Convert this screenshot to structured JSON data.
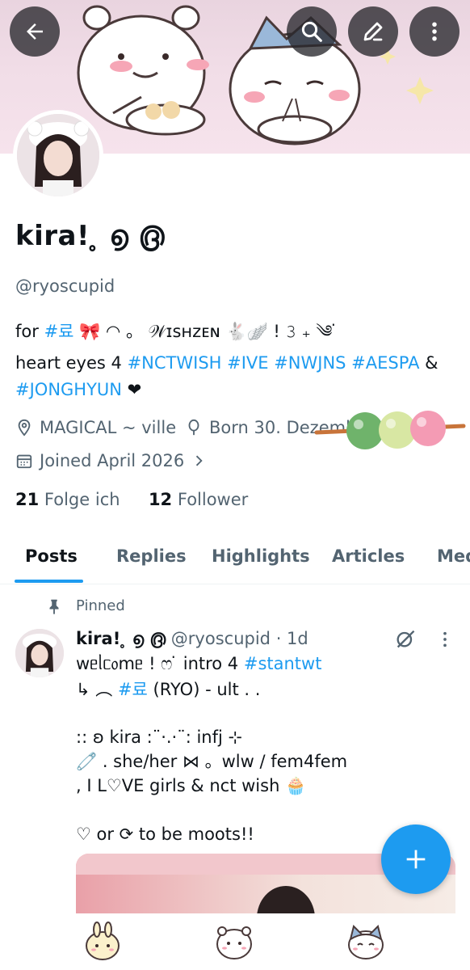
{
  "header": {
    "back_icon": "arrow-left-icon",
    "search_icon": "search-icon",
    "edit_icon": "pencil-icon",
    "more_icon": "more-vertical-icon"
  },
  "profile": {
    "display_name": "kira!  ̥ ൭ ൫",
    "handle": "@ryoscupid",
    "bio_line1_prefix": "for ",
    "bio_line1_tag": "#료",
    "bio_line1_suffix": " 🎀 ◠ 。 𝒲ɪsʜzᴇɴ 🐇🪽 ! 𝟹  ₊ ༄ ̇",
    "bio_line2_prefix": "heart eyes 4 ",
    "bio_line2_tags": "#NCTWISH #IVE #NWJNS #AESPA",
    "bio_line2_suffix": " &",
    "bio_line3_tag": "#JONGHYUN",
    "bio_line3_suffix": " ❤",
    "location": "MAGICAL ~ ville",
    "birthday": "Born 30. Dezemb",
    "joined": "Joined April 2026",
    "following_count": "21",
    "following_label": "Folge ich",
    "followers_count": "12",
    "followers_label": "Follower"
  },
  "tabs": [
    "Posts",
    "Replies",
    "Highlights",
    "Articles",
    "Med"
  ],
  "post": {
    "pinned_label": "Pinned",
    "author_name": "kira!  ̥ ൭ ൫",
    "author_handle": "@ryoscupid",
    "time": "· 1d",
    "line1_prefix": "wᥱᥣᥴ᥆mᥱ ! ෆ ̇ intro 4 ",
    "line1_tag": "#stantwt",
    "line2_prefix": "↳  ︵  ",
    "line2_tag": "#료",
    "line2_suffix": " (RYO) - ult  . .",
    "line3": ":: ʚ kira  :¨·.·¨:  infj ⊹",
    "line4": "🧷 . she/her  ⋈ 。wlw / fem4fem",
    "line5": ", I L♡VE girls & nct wish 🧁",
    "line6": "♡  or  ⟳  to be moots!!"
  },
  "colors": {
    "accent": "#1d9bf0",
    "text": "#0f1419",
    "muted": "#536471"
  }
}
